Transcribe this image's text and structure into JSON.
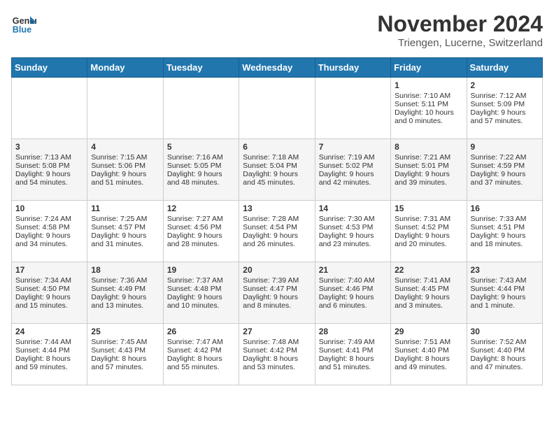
{
  "header": {
    "logo_line1": "General",
    "logo_line2": "Blue",
    "month": "November 2024",
    "location": "Triengen, Lucerne, Switzerland"
  },
  "weekdays": [
    "Sunday",
    "Monday",
    "Tuesday",
    "Wednesday",
    "Thursday",
    "Friday",
    "Saturday"
  ],
  "weeks": [
    [
      {
        "day": "",
        "text": ""
      },
      {
        "day": "",
        "text": ""
      },
      {
        "day": "",
        "text": ""
      },
      {
        "day": "",
        "text": ""
      },
      {
        "day": "",
        "text": ""
      },
      {
        "day": "1",
        "text": "Sunrise: 7:10 AM\nSunset: 5:11 PM\nDaylight: 10 hours\nand 0 minutes."
      },
      {
        "day": "2",
        "text": "Sunrise: 7:12 AM\nSunset: 5:09 PM\nDaylight: 9 hours\nand 57 minutes."
      }
    ],
    [
      {
        "day": "3",
        "text": "Sunrise: 7:13 AM\nSunset: 5:08 PM\nDaylight: 9 hours\nand 54 minutes."
      },
      {
        "day": "4",
        "text": "Sunrise: 7:15 AM\nSunset: 5:06 PM\nDaylight: 9 hours\nand 51 minutes."
      },
      {
        "day": "5",
        "text": "Sunrise: 7:16 AM\nSunset: 5:05 PM\nDaylight: 9 hours\nand 48 minutes."
      },
      {
        "day": "6",
        "text": "Sunrise: 7:18 AM\nSunset: 5:04 PM\nDaylight: 9 hours\nand 45 minutes."
      },
      {
        "day": "7",
        "text": "Sunrise: 7:19 AM\nSunset: 5:02 PM\nDaylight: 9 hours\nand 42 minutes."
      },
      {
        "day": "8",
        "text": "Sunrise: 7:21 AM\nSunset: 5:01 PM\nDaylight: 9 hours\nand 39 minutes."
      },
      {
        "day": "9",
        "text": "Sunrise: 7:22 AM\nSunset: 4:59 PM\nDaylight: 9 hours\nand 37 minutes."
      }
    ],
    [
      {
        "day": "10",
        "text": "Sunrise: 7:24 AM\nSunset: 4:58 PM\nDaylight: 9 hours\nand 34 minutes."
      },
      {
        "day": "11",
        "text": "Sunrise: 7:25 AM\nSunset: 4:57 PM\nDaylight: 9 hours\nand 31 minutes."
      },
      {
        "day": "12",
        "text": "Sunrise: 7:27 AM\nSunset: 4:56 PM\nDaylight: 9 hours\nand 28 minutes."
      },
      {
        "day": "13",
        "text": "Sunrise: 7:28 AM\nSunset: 4:54 PM\nDaylight: 9 hours\nand 26 minutes."
      },
      {
        "day": "14",
        "text": "Sunrise: 7:30 AM\nSunset: 4:53 PM\nDaylight: 9 hours\nand 23 minutes."
      },
      {
        "day": "15",
        "text": "Sunrise: 7:31 AM\nSunset: 4:52 PM\nDaylight: 9 hours\nand 20 minutes."
      },
      {
        "day": "16",
        "text": "Sunrise: 7:33 AM\nSunset: 4:51 PM\nDaylight: 9 hours\nand 18 minutes."
      }
    ],
    [
      {
        "day": "17",
        "text": "Sunrise: 7:34 AM\nSunset: 4:50 PM\nDaylight: 9 hours\nand 15 minutes."
      },
      {
        "day": "18",
        "text": "Sunrise: 7:36 AM\nSunset: 4:49 PM\nDaylight: 9 hours\nand 13 minutes."
      },
      {
        "day": "19",
        "text": "Sunrise: 7:37 AM\nSunset: 4:48 PM\nDaylight: 9 hours\nand 10 minutes."
      },
      {
        "day": "20",
        "text": "Sunrise: 7:39 AM\nSunset: 4:47 PM\nDaylight: 9 hours\nand 8 minutes."
      },
      {
        "day": "21",
        "text": "Sunrise: 7:40 AM\nSunset: 4:46 PM\nDaylight: 9 hours\nand 6 minutes."
      },
      {
        "day": "22",
        "text": "Sunrise: 7:41 AM\nSunset: 4:45 PM\nDaylight: 9 hours\nand 3 minutes."
      },
      {
        "day": "23",
        "text": "Sunrise: 7:43 AM\nSunset: 4:44 PM\nDaylight: 9 hours\nand 1 minute."
      }
    ],
    [
      {
        "day": "24",
        "text": "Sunrise: 7:44 AM\nSunset: 4:44 PM\nDaylight: 8 hours\nand 59 minutes."
      },
      {
        "day": "25",
        "text": "Sunrise: 7:45 AM\nSunset: 4:43 PM\nDaylight: 8 hours\nand 57 minutes."
      },
      {
        "day": "26",
        "text": "Sunrise: 7:47 AM\nSunset: 4:42 PM\nDaylight: 8 hours\nand 55 minutes."
      },
      {
        "day": "27",
        "text": "Sunrise: 7:48 AM\nSunset: 4:42 PM\nDaylight: 8 hours\nand 53 minutes."
      },
      {
        "day": "28",
        "text": "Sunrise: 7:49 AM\nSunset: 4:41 PM\nDaylight: 8 hours\nand 51 minutes."
      },
      {
        "day": "29",
        "text": "Sunrise: 7:51 AM\nSunset: 4:40 PM\nDaylight: 8 hours\nand 49 minutes."
      },
      {
        "day": "30",
        "text": "Sunrise: 7:52 AM\nSunset: 4:40 PM\nDaylight: 8 hours\nand 47 minutes."
      }
    ]
  ]
}
